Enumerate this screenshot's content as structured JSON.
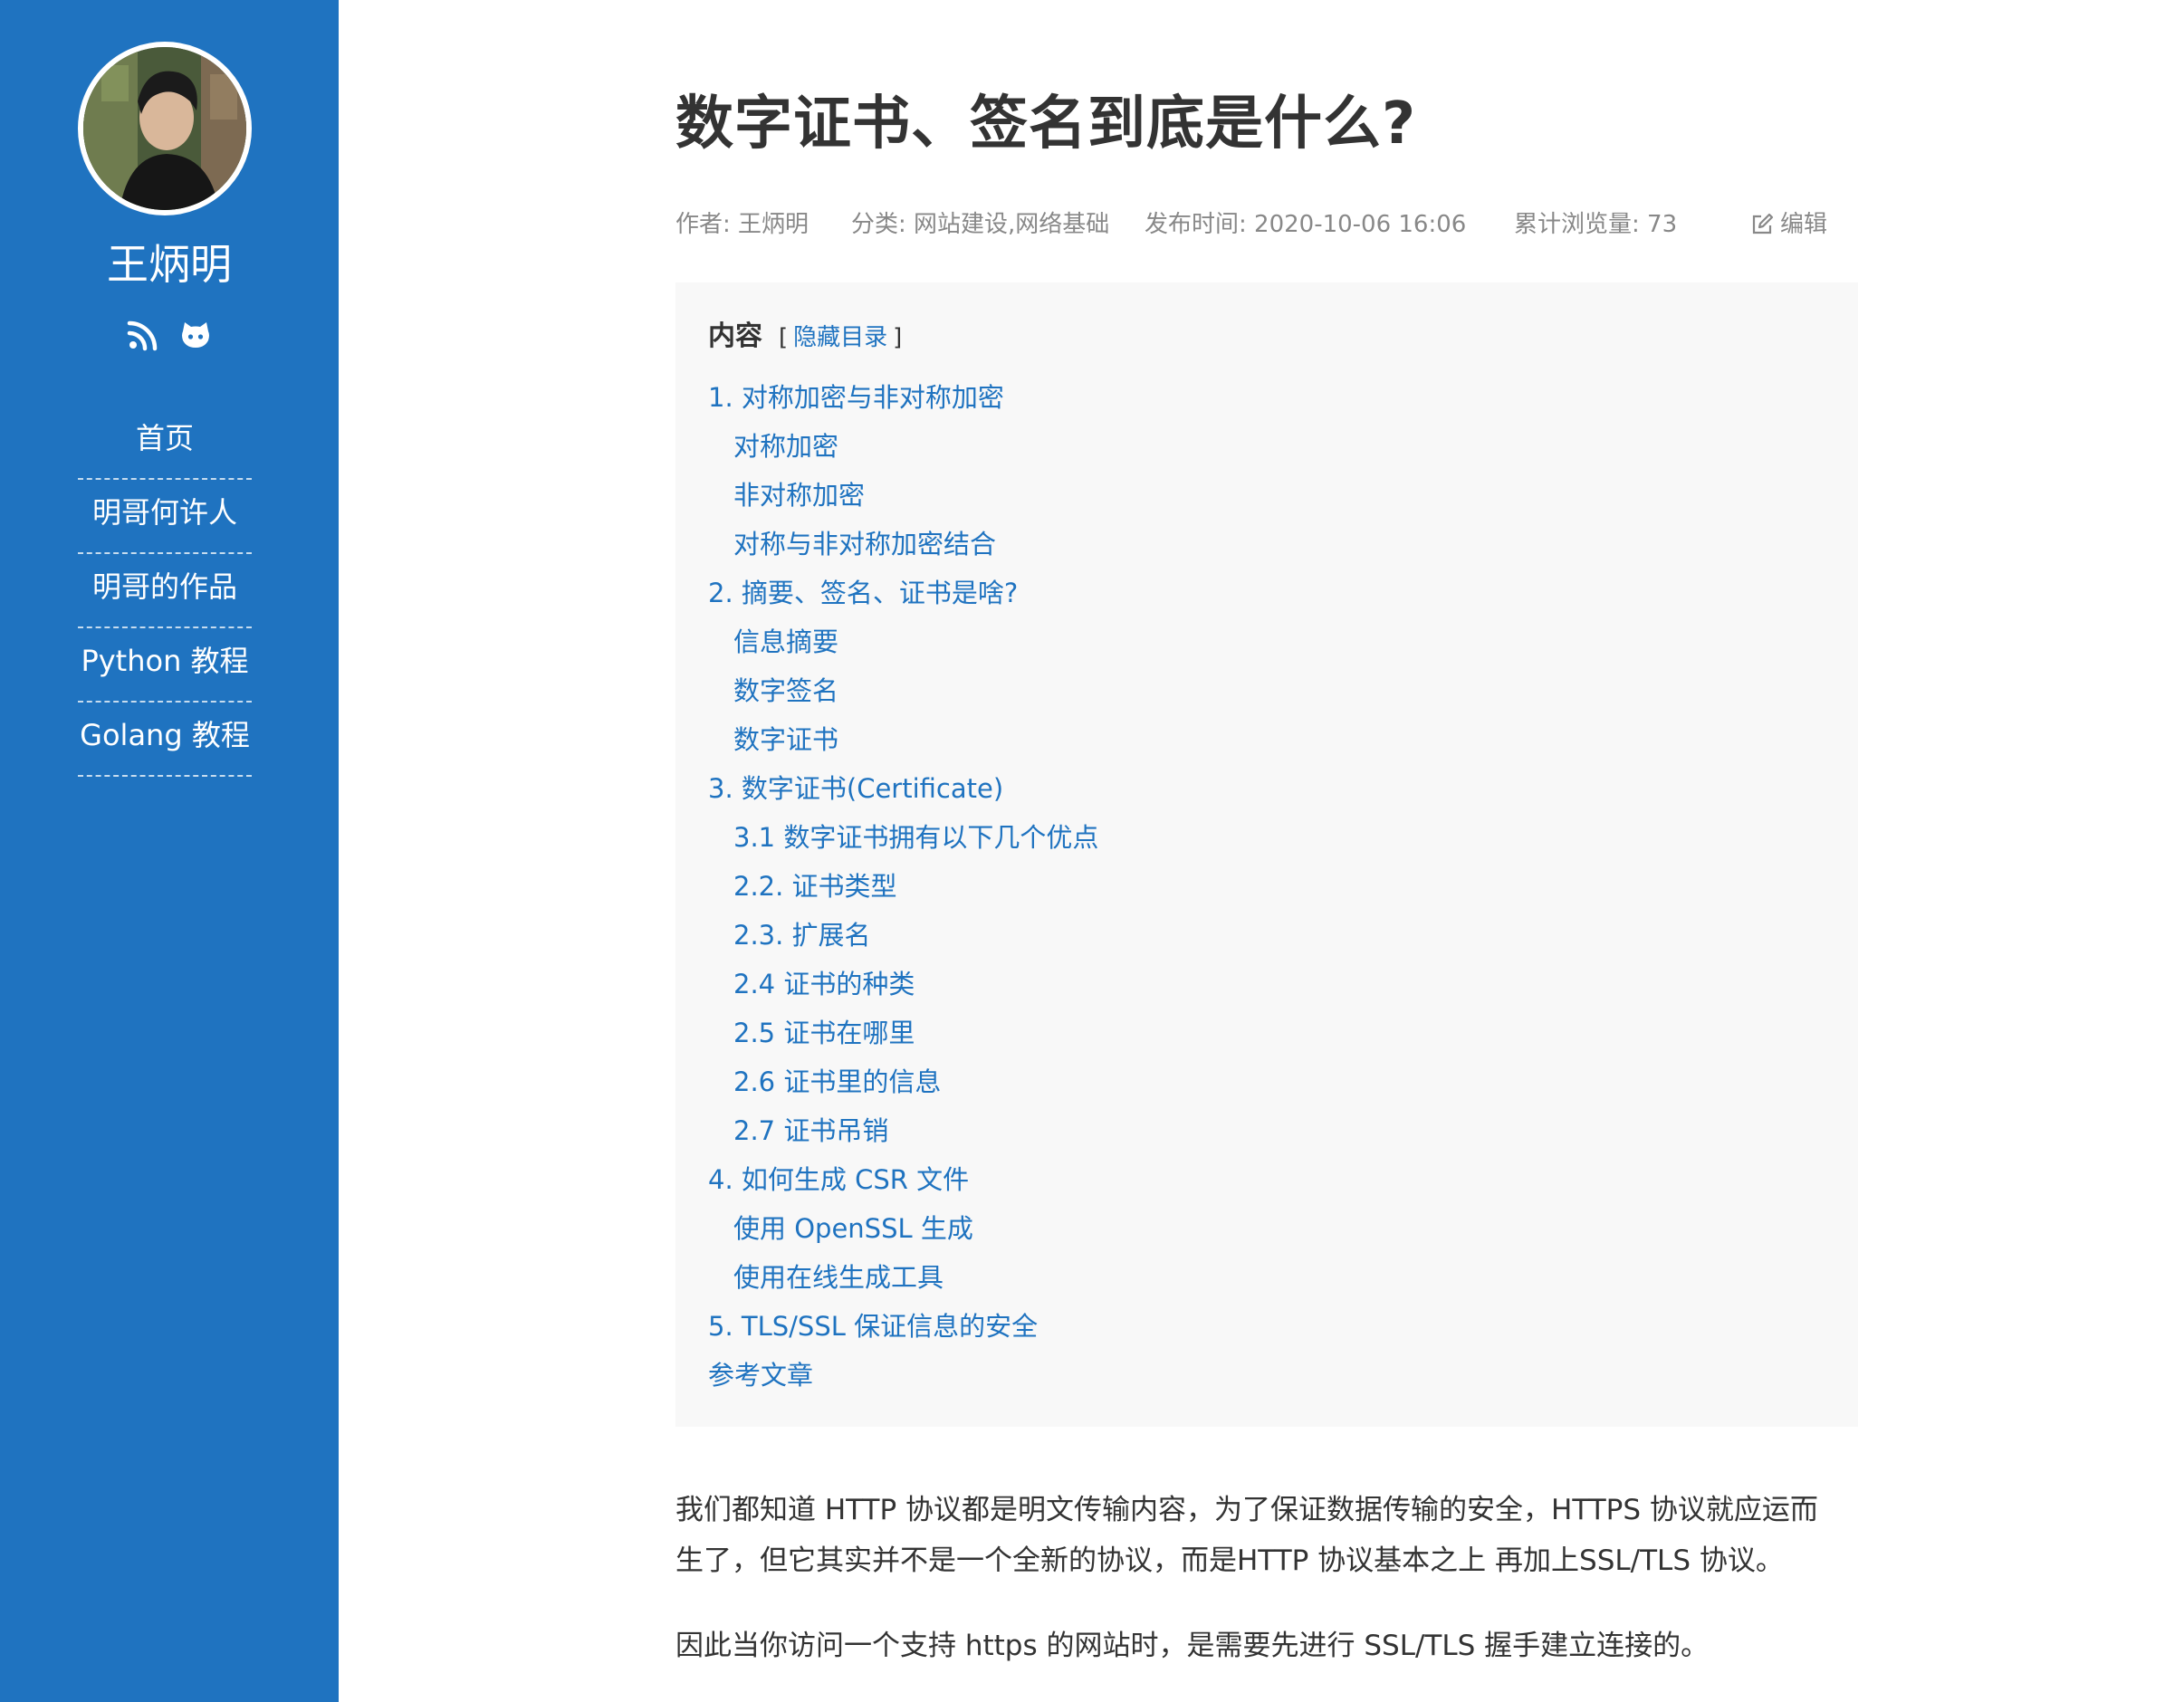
{
  "sidebar": {
    "site_name": "王炳明",
    "social": [
      {
        "icon": "rss-icon"
      },
      {
        "icon": "github-icon"
      }
    ],
    "nav": [
      {
        "label": "首页"
      },
      {
        "label": "明哥何许人"
      },
      {
        "label": "明哥的作品"
      },
      {
        "label": "Python 教程"
      },
      {
        "label": "Golang 教程"
      }
    ]
  },
  "article": {
    "title": "数字证书、签名到底是什么?",
    "meta": {
      "author": "作者: 王炳明",
      "category": "分类: 网站建设,网络基础",
      "published": "发布时间: 2020-10-06 16:06",
      "views": "累计浏览量: 73",
      "edit_label": "编辑"
    },
    "toc": {
      "heading": "内容",
      "bracket_open": "[",
      "toggle_label": "隐藏目录",
      "bracket_close": "]",
      "items": [
        {
          "label": "1. 对称加密与非对称加密",
          "level": 1
        },
        {
          "label": "对称加密",
          "level": 2
        },
        {
          "label": "非对称加密",
          "level": 2
        },
        {
          "label": "对称与非对称加密结合",
          "level": 2
        },
        {
          "label": "2. 摘要、签名、证书是啥?",
          "level": 1
        },
        {
          "label": "信息摘要",
          "level": 2
        },
        {
          "label": "数字签名",
          "level": 2
        },
        {
          "label": "数字证书",
          "level": 2
        },
        {
          "label": "3. 数字证书(Certificate)",
          "level": 1
        },
        {
          "label": "3.1 数字证书拥有以下几个优点",
          "level": 2
        },
        {
          "label": "2.2. 证书类型",
          "level": 2
        },
        {
          "label": "2.3. 扩展名",
          "level": 2
        },
        {
          "label": "2.4 证书的种类",
          "level": 2
        },
        {
          "label": "2.5 证书在哪里",
          "level": 2
        },
        {
          "label": "2.6 证书里的信息",
          "level": 2
        },
        {
          "label": "2.7 证书吊销",
          "level": 2
        },
        {
          "label": "4. 如何生成 CSR 文件",
          "level": 1
        },
        {
          "label": "使用 OpenSSL 生成",
          "level": 2
        },
        {
          "label": "使用在线生成工具",
          "level": 2
        },
        {
          "label": "5. TLS/SSL 保证信息的安全",
          "level": 1
        },
        {
          "label": "参考文章",
          "level": 1
        }
      ]
    },
    "paragraphs": [
      {
        "lines": [
          "我们都知道 HTTP 协议都是明文传输内容，为了保证数据传输的安全，HTTPS 协议就应运而",
          "生了，但它其实并不是一个全新的协议，而是HTTP 协议基本之上 再加上SSL/TLS 协议。"
        ]
      },
      {
        "lines": [
          "因此当你访问一个支持 https 的网站时，是需要先进行 SSL/TLS 握手建立连接的。"
        ]
      }
    ]
  }
}
